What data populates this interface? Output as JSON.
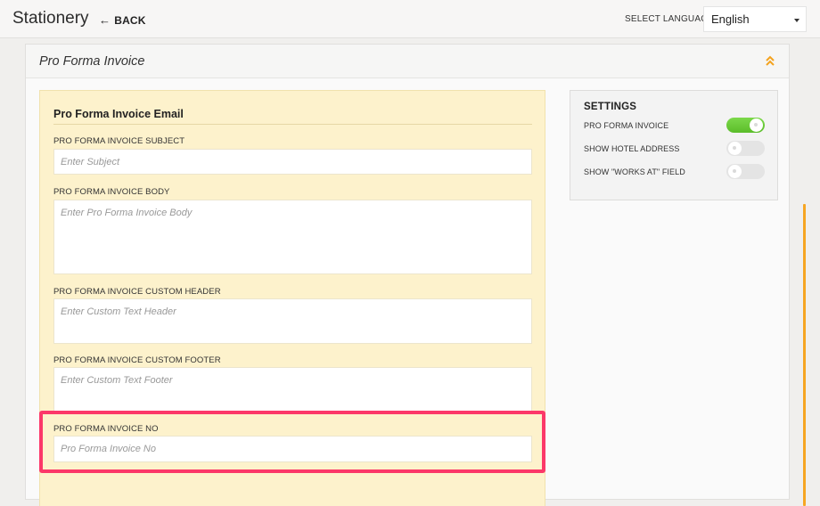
{
  "header": {
    "title": "Stationery",
    "back_label": "BACK",
    "language_label": "SELECT LANGUAGE",
    "language_value": "English"
  },
  "panel": {
    "title": "Pro Forma Invoice"
  },
  "email": {
    "title": "Pro Forma Invoice Email",
    "fields": [
      {
        "label": "PRO FORMA INVOICE SUBJECT",
        "placeholder": "Enter Subject",
        "value": ""
      },
      {
        "label": "PRO FORMA INVOICE BODY",
        "placeholder": "Enter Pro Forma Invoice Body",
        "value": ""
      },
      {
        "label": "PRO FORMA INVOICE CUSTOM HEADER",
        "placeholder": "Enter Custom Text Header",
        "value": ""
      },
      {
        "label": "PRO FORMA INVOICE CUSTOM FOOTER",
        "placeholder": "Enter Custom Text Footer",
        "value": ""
      },
      {
        "label": "PRO FORMA INVOICE NO",
        "placeholder": "Pro Forma Invoice No",
        "value": ""
      }
    ]
  },
  "settings": {
    "title": "SETTINGS",
    "items": [
      {
        "label": "PRO FORMA INVOICE",
        "enabled": true
      },
      {
        "label": "SHOW HOTEL ADDRESS",
        "enabled": false
      },
      {
        "label": "SHOW \"WORKS AT\" FIELD",
        "enabled": false
      }
    ]
  },
  "colors": {
    "highlight": "#fc3869",
    "toggle_on": "#5bbd2a",
    "email_background": "#fdf2cc",
    "accent_orange": "#f6a623"
  },
  "icons": {
    "back": "arrow-left-icon",
    "collapse": "double-chevron-up-icon",
    "language_caret": "caret-down-icon"
  }
}
